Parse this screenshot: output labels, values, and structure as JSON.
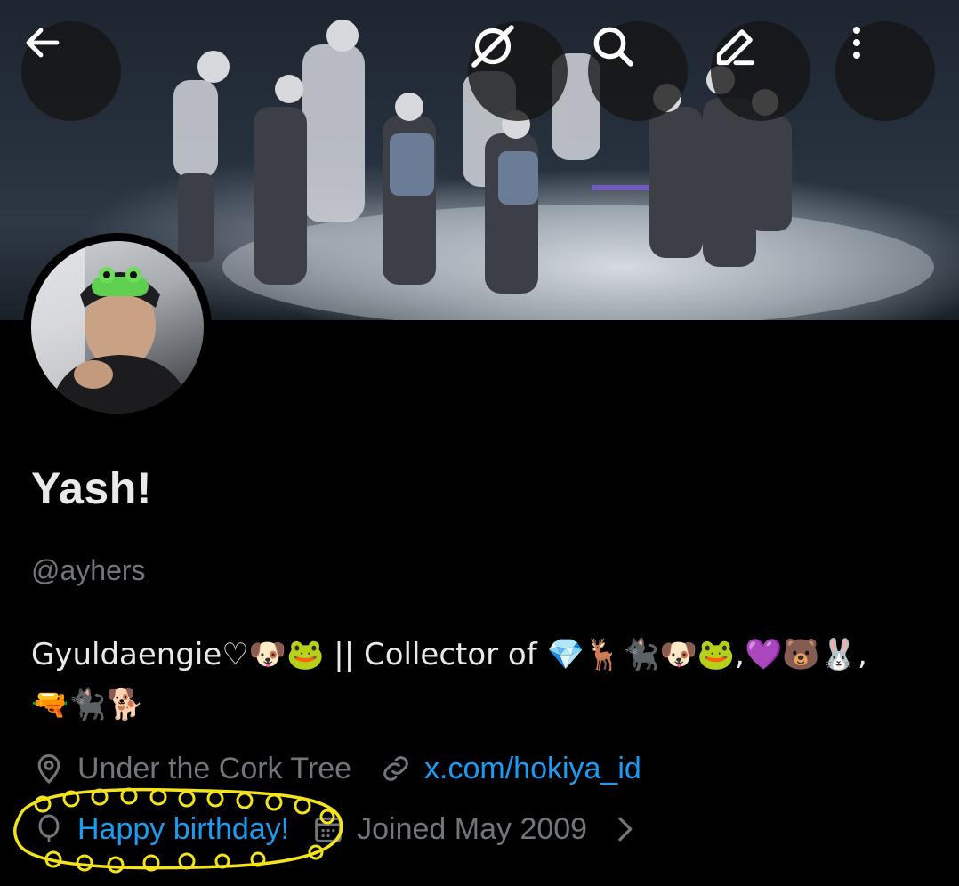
{
  "header": {
    "back_icon": "arrow-left-icon",
    "grok_icon": "grok-icon",
    "search_icon": "search-icon",
    "edit_icon": "edit-pencil-icon",
    "more_icon": "more-vertical-icon"
  },
  "profile": {
    "display_name": "Yash!",
    "handle": "@ayhers",
    "bio": "Gyuldaengie♡🐶🐸 || Collector of 💎🦌🐈‍⬛🐶🐸,💜🐻🐰,\n🔫🐈‍⬛🐕",
    "location": "Under the Cork Tree",
    "website": "x.com/hokiya_id",
    "birthday": "Happy birthday!",
    "joined": "Joined May 2009"
  },
  "colors": {
    "background": "#000000",
    "text_primary": "#e7e9ea",
    "text_secondary": "#71767b",
    "link": "#1d9bf0",
    "highlight_scribble": "#f2e31b"
  }
}
